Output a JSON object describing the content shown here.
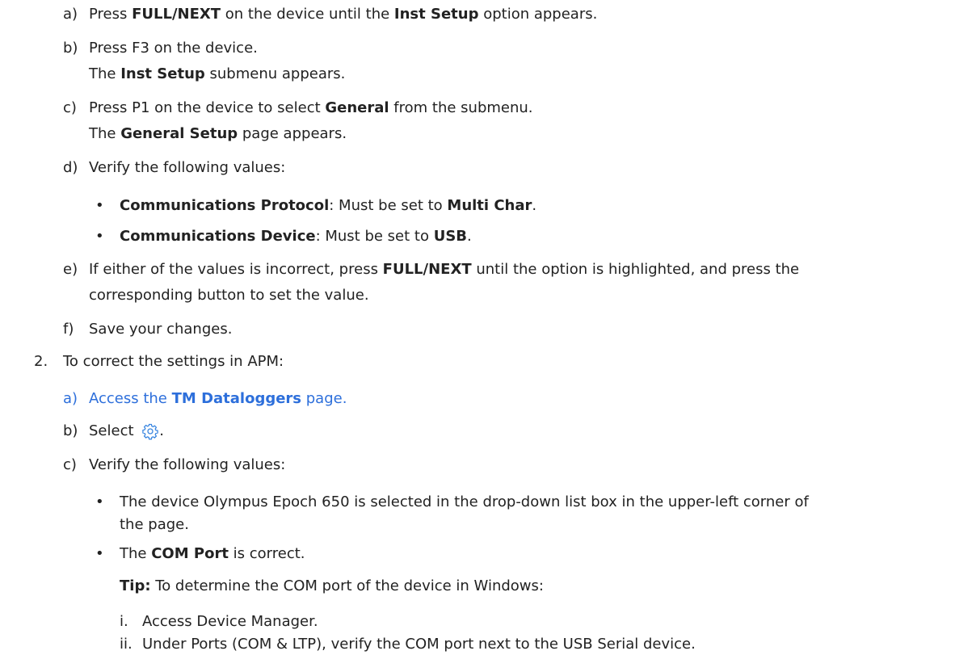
{
  "step1": {
    "a": {
      "marker": "a)",
      "t1": "Press ",
      "b1": "FULL/NEXT",
      "t2": " on the device until the ",
      "b2": "Inst Setup",
      "t3": " option appears."
    },
    "b": {
      "marker": "b)",
      "t1": "Press F3 on the device.",
      "t2": "The ",
      "b1": "Inst Setup",
      "t3": " submenu appears."
    },
    "c": {
      "marker": "c)",
      "t1": "Press P1 on the device to select ",
      "b1": "General",
      "t2": " from the submenu.",
      "t3": "The ",
      "b2": "General Setup",
      "t4": " page appears."
    },
    "d": {
      "marker": "d)",
      "t1": "Verify the following values:",
      "bullets": [
        {
          "b1": "Communications Protocol",
          "t1": ": Must be set to ",
          "b2": "Multi Char",
          "t2": "."
        },
        {
          "b1": "Communications Device",
          "t1": ": Must be set to ",
          "b2": "USB",
          "t2": "."
        }
      ]
    },
    "e": {
      "marker": "e)",
      "t1": "If either of the values is incorrect, press ",
      "b1": "FULL/NEXT",
      "t2": " until the option is highlighted, and press the",
      "t3": "corresponding button to set the value."
    },
    "f": {
      "marker": "f)",
      "t1": "Save your changes."
    }
  },
  "step2": {
    "marker": "2.",
    "t1": "To correct the settings in APM:",
    "a": {
      "marker": "a)",
      "t1": "Access the ",
      "link_bold": "TM Dataloggers",
      "t2": " page."
    },
    "b": {
      "marker": "b)",
      "t1": "Select ",
      "icon": "gear-settings-icon",
      "t2": "."
    },
    "c": {
      "marker": "c)",
      "t1": "Verify the following values:",
      "bullet1": {
        "t1": "The device Olympus Epoch 650 is selected in the drop-down list box in the upper-left corner of",
        "t2": "the page."
      },
      "bullet2": {
        "t1": "The ",
        "b1": "COM Port",
        "t2": " is correct."
      },
      "tip": {
        "b1": "Tip:",
        "t1": " To determine the COM port of the device in Windows:"
      },
      "sub": [
        {
          "marker": "i.",
          "text": "Access Device Manager."
        },
        {
          "marker": "ii.",
          "text": "Under Ports (COM & LTP), verify the COM port next to the USB Serial device."
        }
      ]
    }
  },
  "colors": {
    "text": "#222222",
    "link": "#2d6fdb",
    "icon": "#3a86e0"
  },
  "bullet_char": "•"
}
